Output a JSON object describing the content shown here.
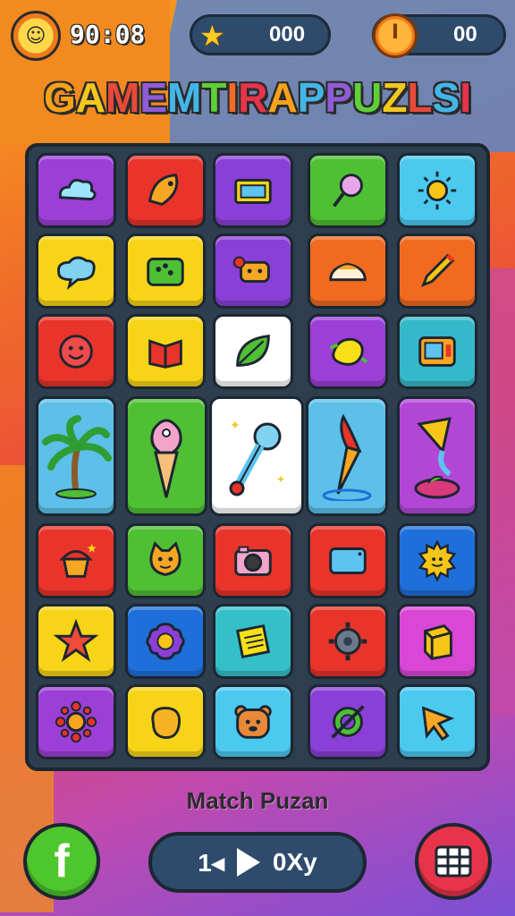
{
  "hud": {
    "timer": "90:08",
    "stars": "000",
    "coins": "00",
    "coin_symbol": "I"
  },
  "title": "GAMEMTIRAPPUZLSI",
  "title_colors": [
    "#f7a21b",
    "#f2c71f",
    "#e84a3a",
    "#8f5cd6",
    "#43b6e8",
    "#5fcf3a",
    "#f06a2a",
    "#e8344a",
    "#f7a21b",
    "#43b6e8",
    "#8f5cd6",
    "#5fcf3a",
    "#f2c71f",
    "#e84a3a",
    "#43b6e8",
    "#e8344a"
  ],
  "board": {
    "rows": [
      [
        {
          "name": "cloud",
          "color": "#9b3fd6"
        },
        {
          "name": "fish",
          "color": "#e8342a"
        },
        {
          "name": "picture-card",
          "color": "#8a3fd6"
        },
        {
          "name": "lollipop",
          "color": "#4fbf34"
        },
        {
          "name": "sun",
          "color": "#4bc9ef"
        }
      ],
      [
        {
          "name": "speech-cloud",
          "color": "#f7d417"
        },
        {
          "name": "domino",
          "color": "#f7d417"
        },
        {
          "name": "toast-face",
          "color": "#8a3fd6"
        },
        {
          "name": "cake",
          "color": "#f06a1f"
        },
        {
          "name": "pencil",
          "color": "#f06a1f"
        }
      ],
      [
        {
          "name": "smile-ball",
          "color": "#e8342a"
        },
        {
          "name": "book",
          "color": "#f7d417"
        },
        {
          "name": "leaf",
          "color": "#ffffff"
        },
        {
          "name": "lemon",
          "color": "#9b3fd6"
        },
        {
          "name": "gadget",
          "color": "#35b8c9"
        }
      ],
      [
        {
          "name": "palm-tree",
          "color": "#5cc0e8",
          "big": true
        },
        {
          "name": "ice-cream",
          "color": "#4fbf34",
          "big": true
        },
        {
          "name": "paint-brush",
          "color": "#ffffff",
          "big": true
        },
        {
          "name": "torch-splash",
          "color": "#5cc0e8",
          "big": true
        },
        {
          "name": "kite",
          "color": "#b247d6",
          "big": true
        }
      ],
      [
        {
          "name": "muffin",
          "color": "#e8342a"
        },
        {
          "name": "cat-face",
          "color": "#4fbf34"
        },
        {
          "name": "camera",
          "color": "#e8342a"
        },
        {
          "name": "tablet",
          "color": "#e8342a"
        },
        {
          "name": "sun-face",
          "color": "#1e6fd9"
        }
      ],
      [
        {
          "name": "star",
          "color": "#f7d417"
        },
        {
          "name": "flower-face",
          "color": "#1e6fd9"
        },
        {
          "name": "note",
          "color": "#35c0c9"
        },
        {
          "name": "gear",
          "color": "#e8342a"
        },
        {
          "name": "cube",
          "color": "#d947d6"
        }
      ],
      [
        {
          "name": "smile-flower",
          "color": "#9b3fd6"
        },
        {
          "name": "bean",
          "color": "#f7d417"
        },
        {
          "name": "bear-face",
          "color": "#4bc9ef"
        },
        {
          "name": "planet",
          "color": "#8a3fd6"
        },
        {
          "name": "cursor-arrow",
          "color": "#4bc9ef"
        }
      ]
    ]
  },
  "footer": {
    "caption": "Match Puzan",
    "play_left": "1◂",
    "play_right": "0Xy",
    "facebook_letter": "f"
  }
}
